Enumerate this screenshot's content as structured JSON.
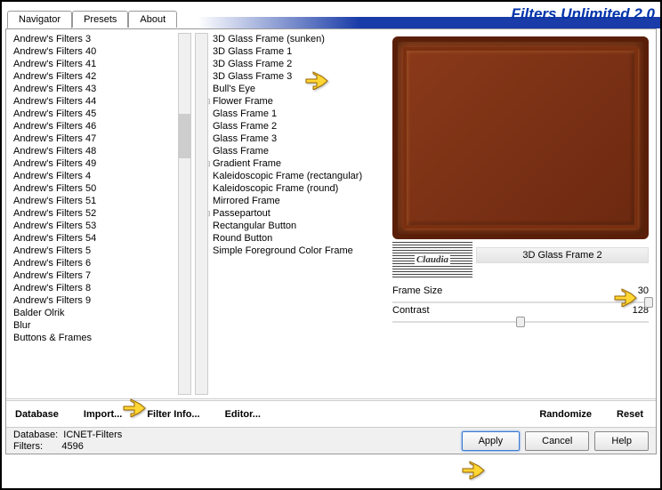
{
  "app": {
    "title": "Filters Unlimited 2.0"
  },
  "tabs": [
    {
      "label": "Navigator"
    },
    {
      "label": "Presets"
    },
    {
      "label": "About"
    }
  ],
  "leftList": [
    "Andrew's Filters 3",
    "Andrew's Filters 40",
    "Andrew's Filters 41",
    "Andrew's Filters 42",
    "Andrew's Filters 43",
    "Andrew's Filters 44",
    "Andrew's Filters 45",
    "Andrew's Filters 46",
    "Andrew's Filters 47",
    "Andrew's Filters 48",
    "Andrew's Filters 49",
    "Andrew's Filters 4",
    "Andrew's Filters 50",
    "Andrew's Filters 51",
    "Andrew's Filters 52",
    "Andrew's Filters 53",
    "Andrew's Filters 54",
    "Andrew's Filters 5",
    "Andrew's Filters 6",
    "Andrew's Filters 7",
    "Andrew's Filters 8",
    "Andrew's Filters 9",
    "Balder Olrik",
    "Blur",
    "Buttons & Frames"
  ],
  "midList": [
    {
      "label": "3D Glass Frame (sunken)",
      "t": false
    },
    {
      "label": "3D Glass Frame 1",
      "t": false
    },
    {
      "label": "3D Glass Frame 2",
      "t": false
    },
    {
      "label": "3D Glass Frame 3",
      "t": false
    },
    {
      "label": "Bull's Eye",
      "t": false
    },
    {
      "label": "Flower Frame",
      "t": true
    },
    {
      "label": "Glass Frame 1",
      "t": false
    },
    {
      "label": "Glass Frame 2",
      "t": false
    },
    {
      "label": "Glass Frame 3",
      "t": false
    },
    {
      "label": "Glass Frame",
      "t": false
    },
    {
      "label": "Gradient Frame",
      "t": true
    },
    {
      "label": "Kaleidoscopic Frame (rectangular)",
      "t": false
    },
    {
      "label": "Kaleidoscopic Frame (round)",
      "t": false
    },
    {
      "label": "Mirrored Frame",
      "t": false
    },
    {
      "label": "Passepartout",
      "t": true
    },
    {
      "label": "Rectangular Button",
      "t": false
    },
    {
      "label": "Round Button",
      "t": false
    },
    {
      "label": "Simple Foreground Color Frame",
      "t": false
    }
  ],
  "watermark": "Claudia",
  "selectedFilter": "3D Glass Frame 2",
  "params": [
    {
      "name": "Frame Size",
      "value": "30",
      "pos": 100
    },
    {
      "name": "Contrast",
      "value": "128",
      "pos": 50
    }
  ],
  "bottomBar1": {
    "database": "Database",
    "import": "Import...",
    "filterInfo": "Filter Info...",
    "editor": "Editor...",
    "randomize": "Randomize",
    "reset": "Reset"
  },
  "status": {
    "dbLabel": "Database:",
    "dbValue": "ICNET-Filters",
    "filtersLabel": "Filters:",
    "filtersValue": "4596"
  },
  "buttons": {
    "apply": "Apply",
    "cancel": "Cancel",
    "help": "Help"
  }
}
